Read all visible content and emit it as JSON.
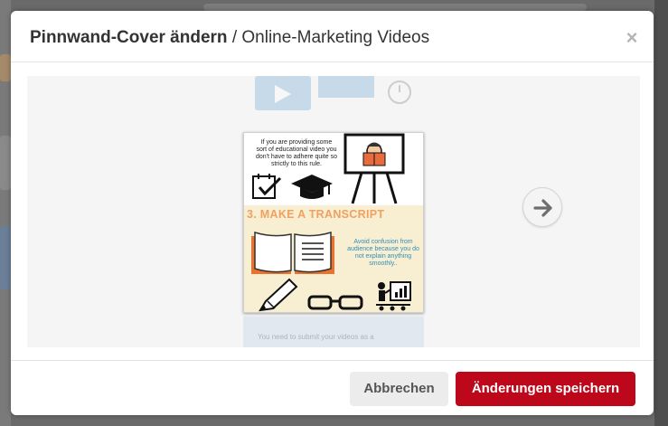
{
  "modal": {
    "title_bold": "Pinnwand-Cover ändern",
    "title_separator": "/",
    "title_board": "Online-Marketing Videos",
    "close_glyph": "×"
  },
  "cover": {
    "text_top": "If you are providing some sort of educational video you don't have to adhere quite so strictly to this rule.",
    "heading": "3. MAKE A TRANSCRIPT",
    "text_bottom": "Avoid confusion from audience because you do not explain anything smoothly..",
    "icons": [
      "presenter-icon",
      "checklist-icon",
      "graduation-cap-icon",
      "book-icon",
      "pencil-icon",
      "glasses-icon",
      "chart-presentation-icon"
    ]
  },
  "next_cover": {
    "snippet": "You need to submit your videos as a"
  },
  "navigation": {
    "next_icon": "arrow-right-icon"
  },
  "footer": {
    "cancel_label": "Abbrechen",
    "save_label": "Änderungen speichern"
  },
  "colors": {
    "primary_button": "#bd081c",
    "cancel_button": "#ececec",
    "heading_accent": "#f0a060",
    "text_accent": "#2f8db8"
  }
}
